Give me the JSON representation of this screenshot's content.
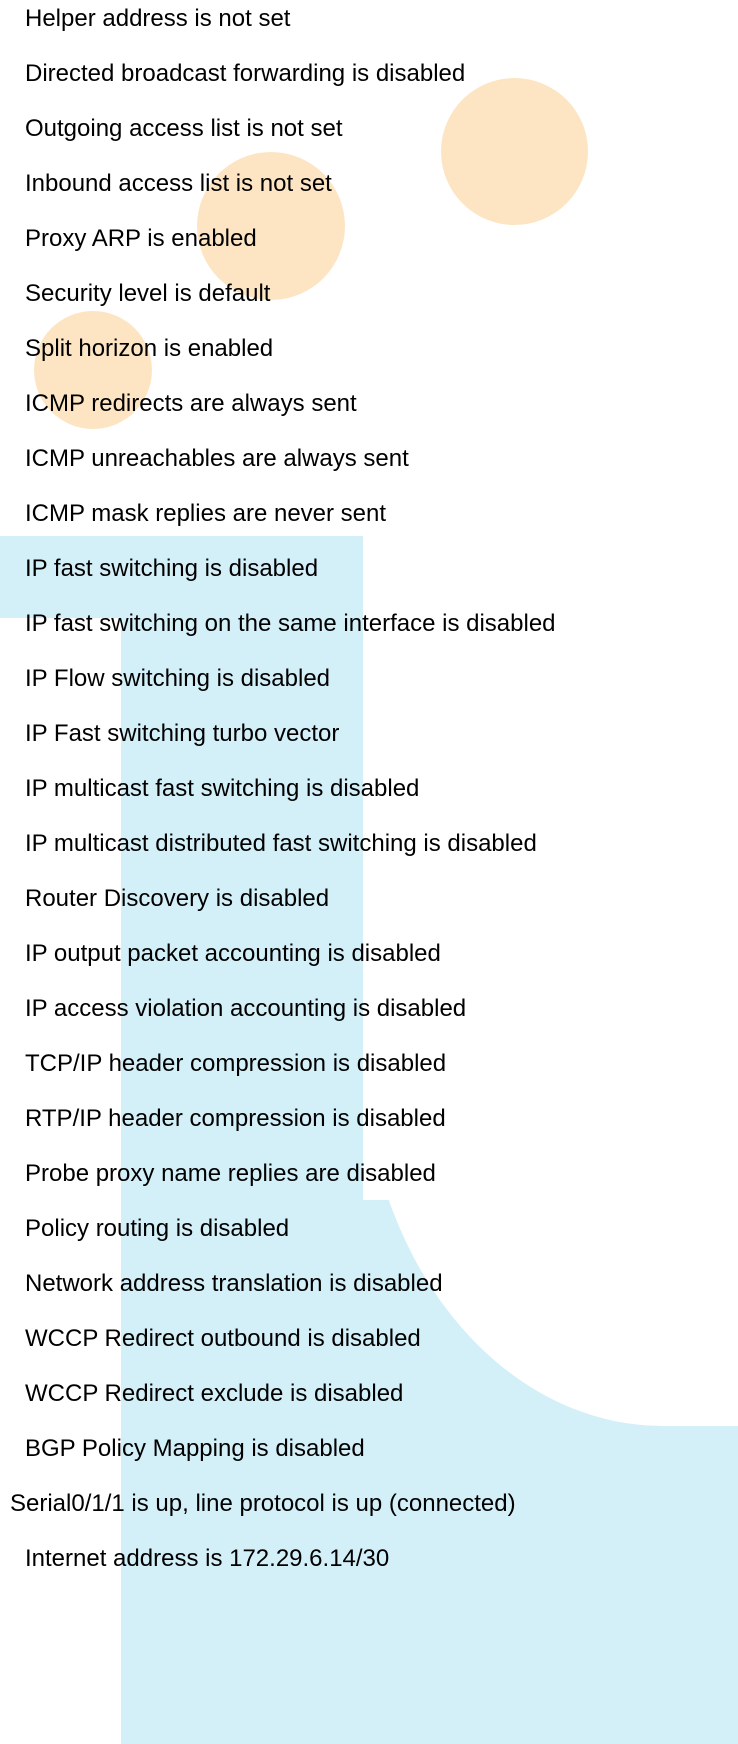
{
  "colors": {
    "text": "#000000",
    "background": "#ffffff",
    "accent_orange": "#fde5c4",
    "accent_blue": "#d3eff8"
  },
  "lines": [
    "Helper address is not set",
    "Directed broadcast forwarding is disabled",
    "Outgoing access list is not set",
    "Inbound  access list is not set",
    "Proxy ARP is enabled",
    "Security level is default",
    "Split horizon is enabled",
    "ICMP redirects are always sent",
    "ICMP unreachables are always sent",
    "ICMP mask replies are never sent",
    "IP fast switching is disabled",
    "IP fast switching on the same interface is disabled",
    "IP Flow switching is disabled",
    "IP Fast switching turbo vector",
    "IP multicast fast switching is disabled",
    "IP multicast distributed fast switching is disabled",
    "Router Discovery is disabled",
    "IP output packet accounting is disabled",
    "IP access violation accounting is disabled",
    "TCP/IP header compression is disabled",
    "RTP/IP header compression is disabled",
    "Probe proxy name replies are disabled",
    "Policy routing is disabled",
    "Network address translation is disabled",
    "WCCP Redirect outbound is disabled",
    "WCCP Redirect exclude is disabled",
    "BGP Policy Mapping is disabled",
    "Serial0/1/1 is up, line protocol is up (connected)",
    "Internet address is 172.29.6.14/30"
  ]
}
